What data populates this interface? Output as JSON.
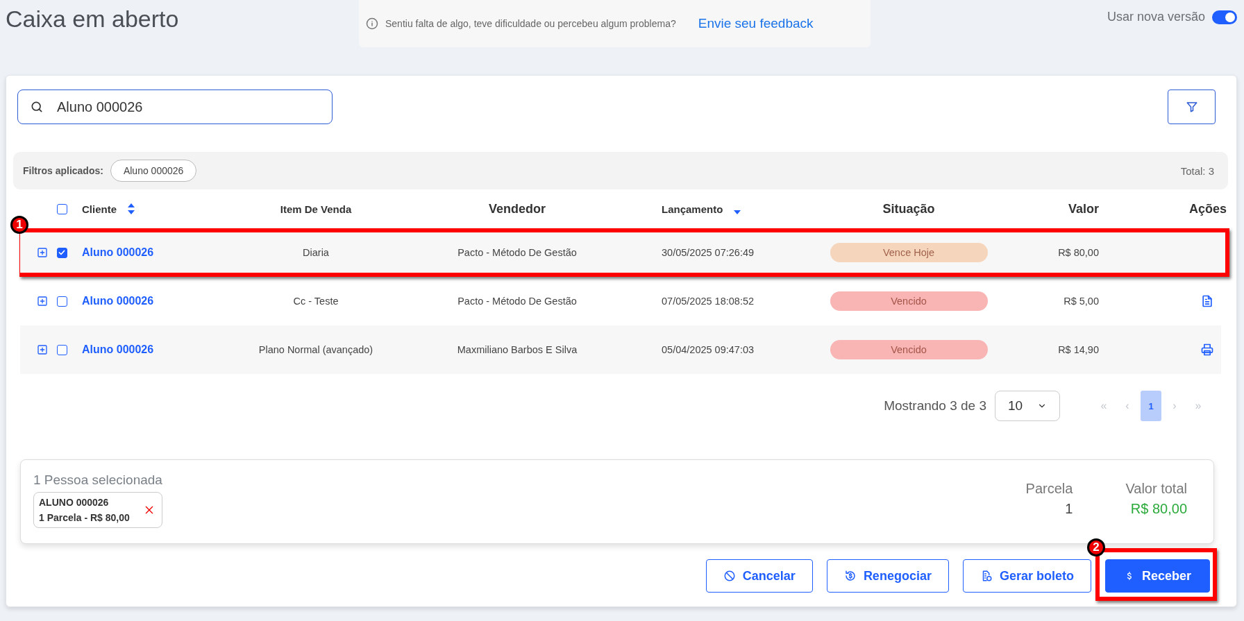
{
  "page": {
    "title": "Caixa em aberto"
  },
  "feedback": {
    "message": "Sentiu falta de algo, teve dificuldade ou percebeu algum problema?",
    "link": "Envie seu feedback"
  },
  "version_toggle": {
    "label": "Usar nova versão",
    "on": true
  },
  "search": {
    "value": "Aluno 000026"
  },
  "filters": {
    "label": "Filtros aplicados:",
    "chips": [
      "Aluno 000026"
    ],
    "total": "Total: 3"
  },
  "table": {
    "select_all": {
      "checked": false
    },
    "columns": [
      {
        "label": "Cliente",
        "kind": "sort-both"
      },
      {
        "label": "Item De Venda"
      },
      {
        "label": "Vendedor"
      },
      {
        "label": "Lançamento",
        "kind": "sort-desc"
      },
      {
        "label": "Situação"
      },
      {
        "label": "Valor"
      },
      {
        "label": "Ações"
      }
    ],
    "rows": [
      {
        "checked": true,
        "client": "Aluno 000026",
        "item": "Diaria",
        "seller": "Pacto - Método De Gestão",
        "date": "30/05/2025 07:26:49",
        "status": {
          "label": "Vence Hoje",
          "color": "#f5d5bb"
        },
        "value": "R$ 80,00",
        "callout": "1"
      },
      {
        "checked": false,
        "client": "Aluno 000026",
        "item": "Cc - Teste",
        "seller": "Pacto - Método De Gestão",
        "date": "07/05/2025 18:08:52",
        "status": {
          "label": "Vencido",
          "color": "#f9b4b4"
        },
        "value": "R$ 5,00",
        "kind": "document"
      },
      {
        "checked": false,
        "client": "Aluno 000026",
        "item": "Plano Normal (avançado)",
        "seller": "Maxmiliano Barbos E Silva",
        "date": "05/04/2025 09:47:03",
        "status": {
          "label": "Vencido",
          "color": "#f9b4b4"
        },
        "value": "R$ 14,90",
        "kind": "print"
      }
    ]
  },
  "pagination": {
    "showing": "Mostrando 3 de 3",
    "page_size": "10",
    "pages": [
      {
        "label": "«",
        "selected": false,
        "disabled": true
      },
      {
        "label": "‹",
        "selected": false,
        "disabled": true
      },
      {
        "label": "1",
        "selected": true,
        "disabled": false
      },
      {
        "label": "›",
        "selected": false,
        "disabled": true
      },
      {
        "label": "»",
        "selected": false,
        "disabled": true
      }
    ]
  },
  "selection": {
    "title": "1 Pessoa selecionada",
    "items": [
      {
        "name": "ALUNO 000026",
        "detail": "1 Parcela - R$ 80,00"
      }
    ],
    "parcel_label": "Parcela",
    "parcel_count": "1",
    "total_label": "Valor total",
    "total_value": "R$ 80,00"
  },
  "actions": [
    {
      "label": "Cancelar",
      "kind": "cancel"
    },
    {
      "label": "Renegociar",
      "kind": "renegotiate"
    },
    {
      "label": "Gerar boleto",
      "kind": "boleto"
    },
    {
      "label": "Receber",
      "kind": "receive",
      "callout": "2"
    }
  ]
}
